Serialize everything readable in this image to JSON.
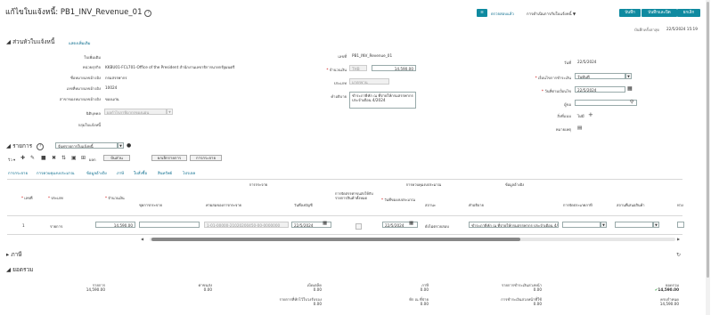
{
  "page": {
    "title": "แก้ไขใบแจ้งหนี้: PB1_INV_Revenue_01",
    "help_glyph": "?"
  },
  "toolbar": {
    "icon_button": "≡",
    "review_link": "ตรวจสอบแล้ว",
    "actions_label": "การดำเนินการกับใบแจ้งหนี้",
    "save_label": "บันทึก",
    "save_close_label": "บันทึกและปิด",
    "cancel_label": "ยกเลิก",
    "last_saved_label": "บันทึกครั้งล่าสุด",
    "last_saved_value": "22/5/2024 15:19"
  },
  "header_section": {
    "title": "ส่วนหัวใบแจ้งหนี้",
    "show_more": "แสดงเพิ่มเติม",
    "left": [
      {
        "label": "ใบเพิ่มเติม",
        "value": ""
      },
      {
        "label": "หน่วยธุรกิจ",
        "value": "KKBU01-FCL701-Office of the President สำนักงานเลขาธิการนายกรัฐมนตรี"
      },
      {
        "label": "ชื่อหมายเลขอ้างอิง",
        "value": "กรมสรรพากร"
      },
      {
        "label": "เลขที่หมายเลขอ้างอิง",
        "value": "10024"
      },
      {
        "label": "สาขาของหมายเลขอ้างอิง",
        "value": "ของแก่น"
      },
      {
        "label": "นิติบุคคล",
        "value": "ผลกำไรภาษีอากรของแผ่น"
      },
      {
        "label": "กลุ่มใบแจ้งหนี้",
        "value": ""
      }
    ],
    "number_label": "เลขที่",
    "number_value": "PB1_INV_Revenue_01",
    "amount_label": "จำนวนเงิน",
    "currency": "THB",
    "amount_value": "14,590.00",
    "type_label": "ประเภท",
    "type_value": "มาตรฐาน",
    "description_label": "คำอธิบาย",
    "description_value": "ชำระภาษีหัก ณ ที่จ่ายให้กรมสรรพากร ประจำเดือน 4/2024",
    "date_label": "วันที่",
    "date_value": "22/5/2024",
    "payment_terms_label": "เงื่อนไขการชำระเงิน",
    "payment_terms_value": "วันทันที",
    "terms_date_label": "วันที่ตามเงื่อนไข",
    "terms_date_value": "22/5/2024",
    "requester_label": "ผู้ขอ",
    "requester_value": "",
    "attachments_label": "สิ่งที่แนบ",
    "attachments_value": "ไม่มี",
    "notes_label": "หมายเหตุ",
    "notes_icon": "▤"
  },
  "lines_section": {
    "title": "รายการ",
    "select_value": "จับคู่รายการใบแจ้งหนี้",
    "view_label": "วิว",
    "export_label": "ผลก",
    "distribution_btn": "ปันส่วน",
    "cancel_line_btn": "ยกเลิกรายการ",
    "tax_btn": "การกระจาย",
    "tabs": [
      "การกระจาย",
      "การควบคุมงบประมาณ",
      "ข้อมูลอ้างอิง",
      "ภาษี",
      "ใบสั่งซื้อ",
      "สินทรัพย์",
      "โปรเจค"
    ],
    "group_headers": {
      "distribution": "การกระจาย",
      "budget": "การควบคุมงบประมาณ",
      "reference": "ข้อมูลอ้างอิง"
    },
    "columns": [
      "เลขที่",
      "ประเภท",
      "จำนวนเงิน",
      "ชุดการกระจาย",
      "ค่าผสมของการกระจาย",
      "วันที่ลงบัญชี",
      "การจัดสรรค่าขนส่งให้กับรายการสินค้าทั้งหมด",
      "วันที่ของงบประมาณ",
      "สถานะ",
      "คำอธิบาย",
      "การจัดประเภทภาษี",
      "สถานที่เสนอสินค้า",
      "ห่วง"
    ],
    "rows": [
      {
        "number": "1",
        "type": "รายการ",
        "amount": "14,590.00",
        "distribution_set": "",
        "distribution_combination": "1-01-00000-21020200450-00-0000000",
        "accounting_date": "22/5/2024",
        "budget_date": "22/5/2024",
        "status": "ยังไม่ตรวจสอบ",
        "description": "ชำระภาษีหัก ณ ที่จ่ายให้กรมสรรพากร ประจำเดือน 4/2024",
        "tax_classification": "",
        "ship_from": ""
      }
    ]
  },
  "tax_section": {
    "title": "ภาษี"
  },
  "totals_section": {
    "title": "ยอดรวม",
    "items": [
      {
        "label": "รายการ",
        "value": "14,590.00"
      },
      {
        "label": "ค่าขนส่ง",
        "value": "0.00"
      },
      {
        "label": "เบ็ดเตล็ด",
        "value": "0.00"
      },
      {
        "label": "รายการที่หักไว้ใบวงรับรอง",
        "value": "0.00"
      },
      {
        "label": "ภาษี",
        "value": "0.00"
      },
      {
        "label": "หัก ณ ที่จ่าย",
        "value": "0.00"
      },
      {
        "label": "รายการชำระเงินล่วงหน้า",
        "value": "0.00"
      },
      {
        "label": "การชำระเงินล่วงหน้าที่ใช้",
        "value": "0.00"
      },
      {
        "label": "ยอดรวม",
        "value": "14,590.00"
      },
      {
        "label": "ครบกำหนด",
        "value": "14,590.00"
      }
    ]
  },
  "colors": {
    "accent": "#0f8aa0",
    "link": "#0d6e8f",
    "check_green": "#2e9e3e"
  }
}
